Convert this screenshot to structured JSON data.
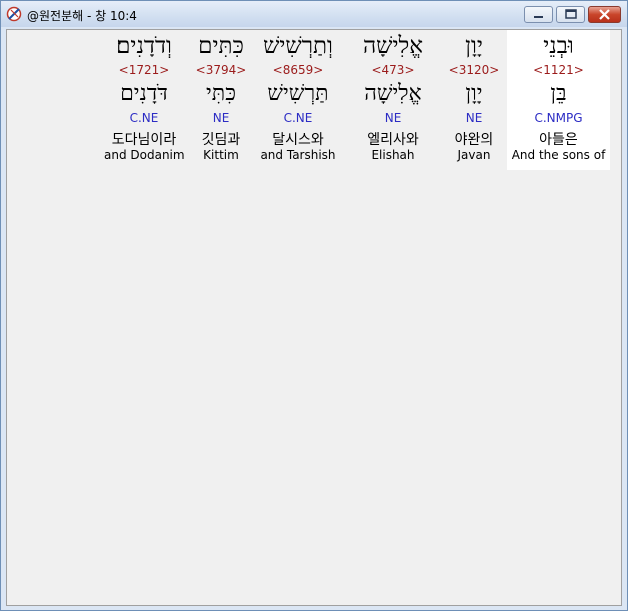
{
  "window": {
    "title": "@원전분해 - 창 10:4",
    "controls": {
      "minimize_icon": "minimize-icon",
      "maximize_icon": "maximize-icon",
      "close_icon": "close-icon"
    }
  },
  "colors": {
    "strong": "#9b1b1b",
    "morph": "#2c2cc4",
    "highlight_bg": "#ffffff",
    "content_bg": "#f0f0f0"
  },
  "words": [
    {
      "hebrew": "וּבְנֵי",
      "strong": "<1121>",
      "lemma": "בֵּן",
      "morph": "C.NMPG",
      "korean": "아들은",
      "english": "And the sons of",
      "highlighted": true
    },
    {
      "hebrew": "יָוָן",
      "strong": "<3120>",
      "lemma": "יָוָן",
      "morph": "NE",
      "korean": "야완의",
      "english": "Javan",
      "highlighted": false
    },
    {
      "hebrew": "אֱלִישָׁה",
      "strong": "<473>",
      "lemma": "אֱלִישָׁה",
      "morph": "NE",
      "korean": "엘리사와",
      "english": "Elishah",
      "highlighted": false
    },
    {
      "hebrew": "וְתַרְשִׁישׁ",
      "strong": "<8659>",
      "lemma": "תַּרְשִׁישׁ",
      "morph": "C.NE",
      "korean": "달시스와",
      "english": "and Tarshish",
      "highlighted": false
    },
    {
      "hebrew": "כִּתִּים",
      "strong": "<3794>",
      "lemma": "כִּתִּי",
      "morph": "NE",
      "korean": "깃딤과",
      "english": "Kittim",
      "highlighted": false
    },
    {
      "hebrew": "וְדֹדָנִים׃",
      "strong": "<1721>",
      "lemma": "דֹּדָנִים",
      "morph": "C.NE",
      "korean": "도다님이라",
      "english": "and Dodanim",
      "highlighted": false
    }
  ]
}
